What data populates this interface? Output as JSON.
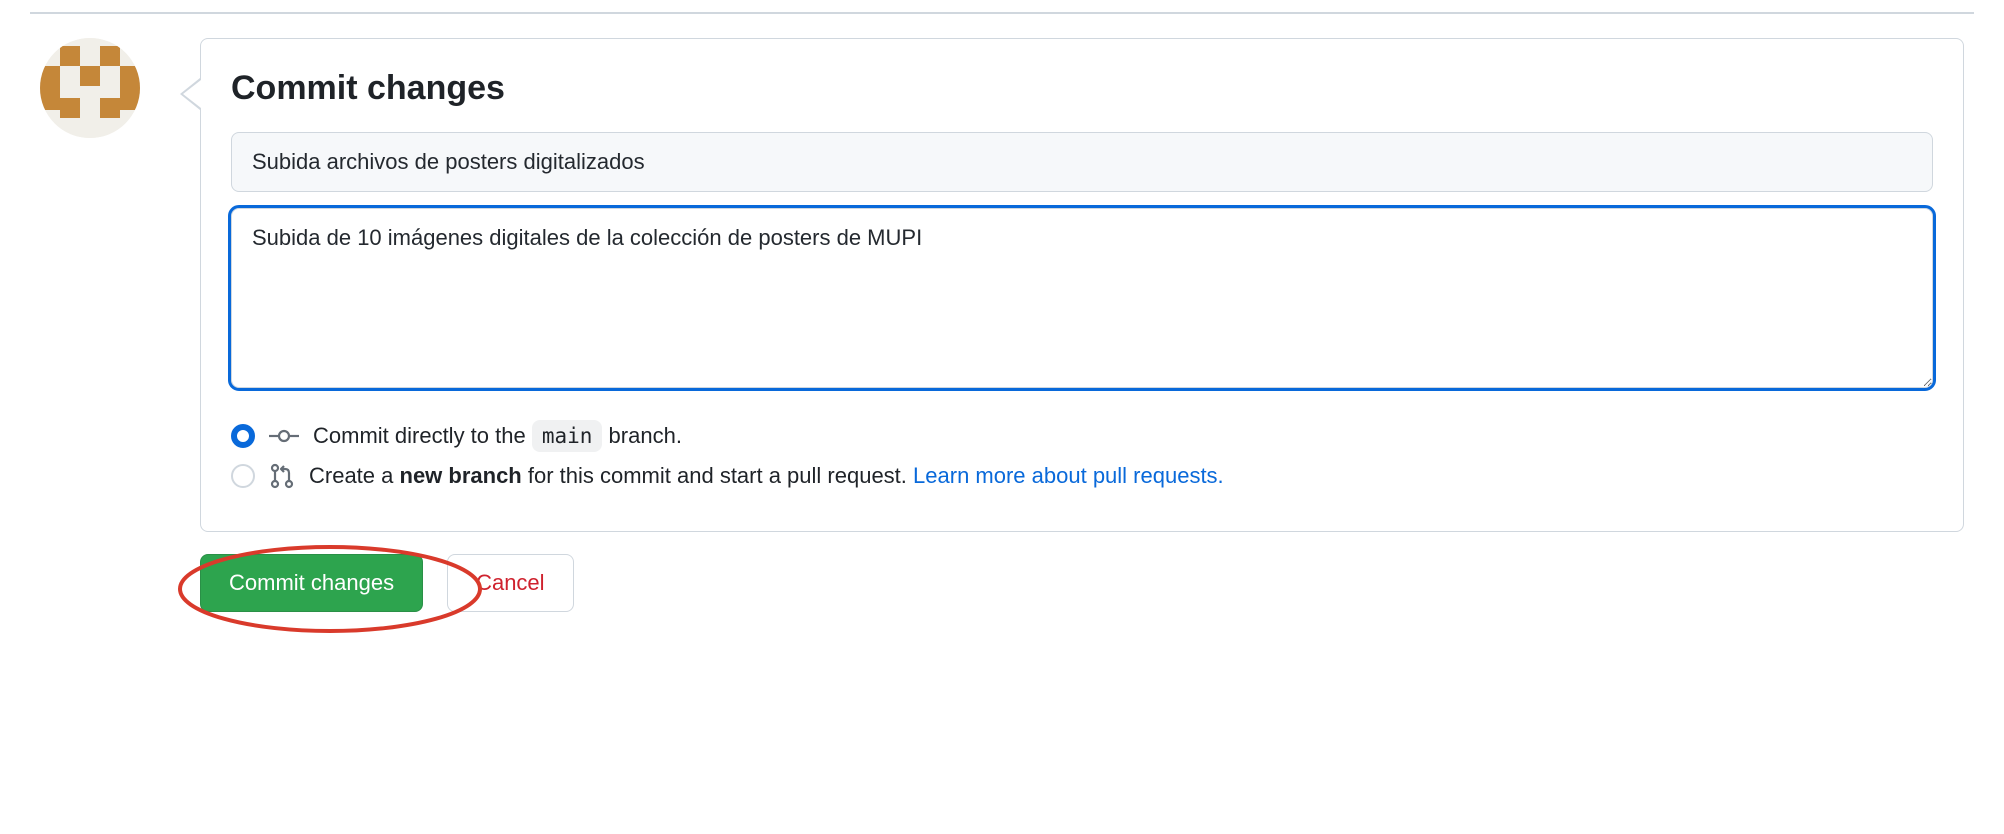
{
  "heading": "Commit changes",
  "commit_summary": "Subida archivos de posters digitalizados",
  "commit_description": "Subida de 10 imágenes digitales de la colección de posters de MUPI",
  "branch_options": {
    "direct": {
      "prefix": "Commit directly to the ",
      "branch_name": "main",
      "suffix": " branch."
    },
    "new_branch": {
      "prefix": "Create a ",
      "bold": "new branch",
      "suffix": " for this commit and start a pull request. ",
      "link_text": "Learn more about pull requests."
    }
  },
  "buttons": {
    "commit": "Commit changes",
    "cancel": "Cancel"
  }
}
